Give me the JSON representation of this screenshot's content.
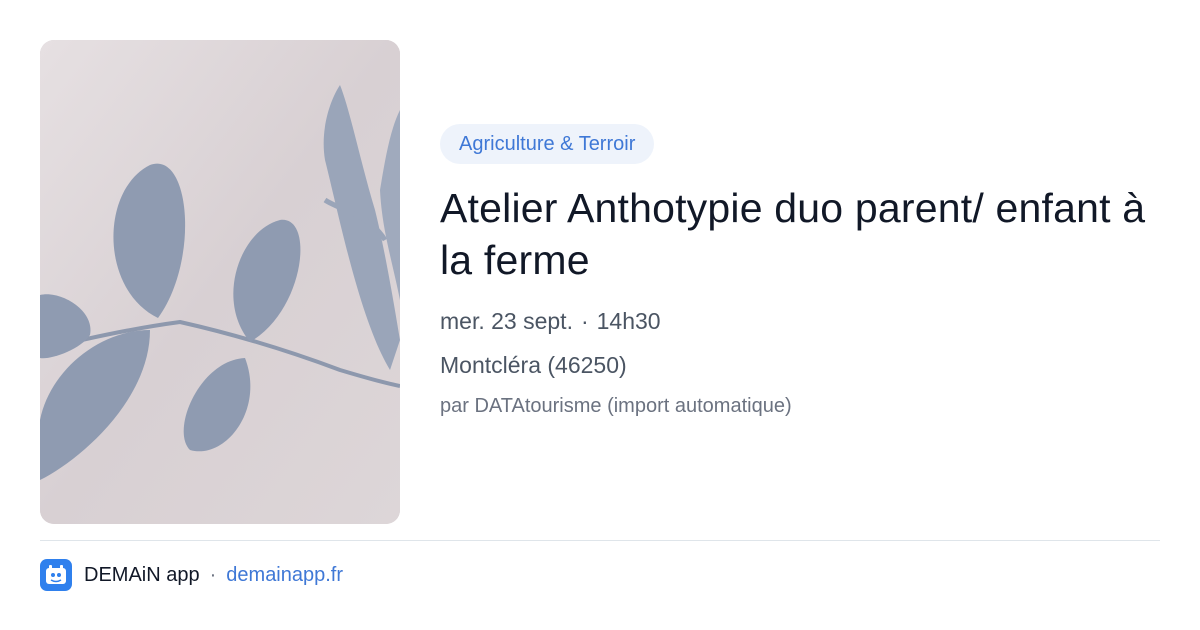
{
  "card": {
    "category_tag": "Agriculture & Terroir",
    "title": "Atelier Anthotypie duo parent/ enfant à la ferme",
    "date": "mer. 23 sept.",
    "time": "14h30",
    "separator": "·",
    "location": "Montcléra (46250)",
    "source": "par DATAtourisme (import automatique)"
  },
  "footer": {
    "app_name": "DEMAiN app",
    "separator": "·",
    "link": "demainapp.fr",
    "icon": "demain-app-logo-icon"
  },
  "colors": {
    "tag_background": "#eef3fb",
    "tag_text": "#3f78d6",
    "title": "#111827",
    "link": "#3f78d6",
    "app_icon": "#2f80ed"
  }
}
